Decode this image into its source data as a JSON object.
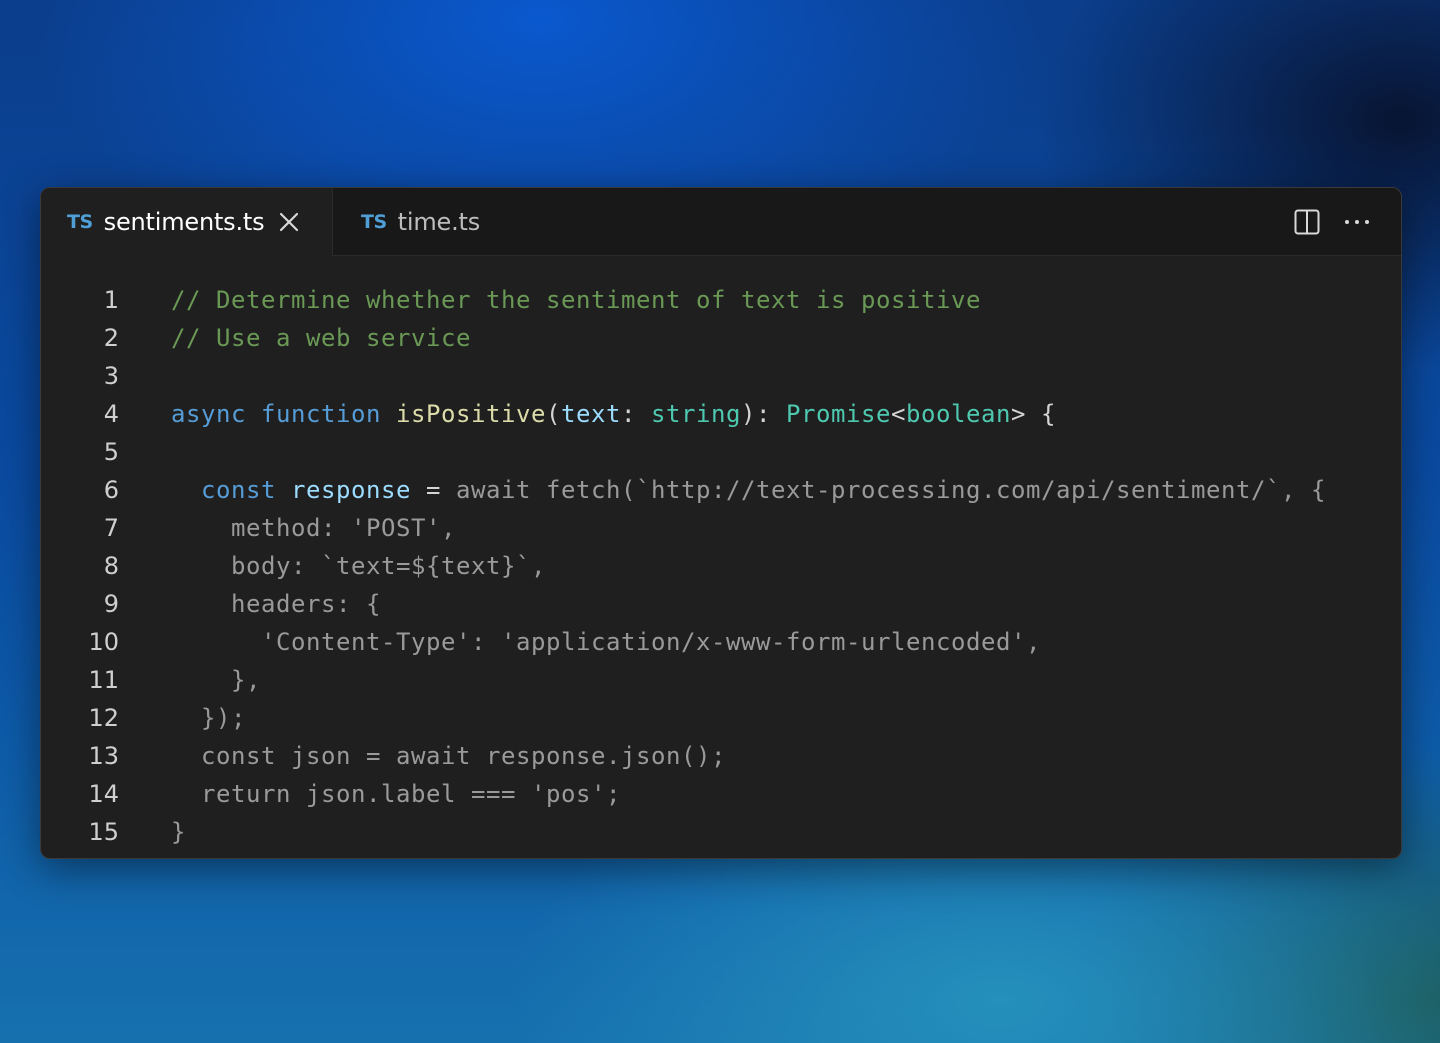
{
  "tabs": [
    {
      "icon": "TS",
      "label": "sentiments.ts",
      "active": true
    },
    {
      "icon": "TS",
      "label": "time.ts",
      "active": false
    }
  ],
  "actions": [
    "split-editor-icon",
    "more-actions-icon"
  ],
  "colors": {
    "comment": "#6a9955",
    "keyword": "#569cd6",
    "function": "#dcdcaa",
    "parameter": "#9cdcfe",
    "type": "#4ec9b0",
    "dimmed": "#9a9a9a",
    "editor_bg": "#1f1f1f"
  },
  "code": {
    "line_numbers": [
      "1",
      "2",
      "3",
      "4",
      "5",
      "6",
      "7",
      "8",
      "9",
      "10",
      "11",
      "12",
      "13",
      "14",
      "15"
    ],
    "l1": "// Determine whether the sentiment of text is positive",
    "l2": "// Use a web service",
    "l4": {
      "kw_async": "async",
      "kw_function": "function",
      "fn_name": "isPositive",
      "open": "(",
      "param": "text",
      "colon": ": ",
      "type_string": "string",
      "close": "): ",
      "type_promise": "Promise",
      "lt": "<",
      "type_boolean": "boolean",
      "gt": "> {"
    },
    "l6": {
      "indent": "  ",
      "kw_const": "const",
      "var": "response",
      "eq": " = ",
      "rest": "await fetch(`http://text-processing.com/api/sentiment/`, {"
    },
    "l7": "    method: 'POST',",
    "l8": "    body: `text=${text}`,",
    "l9": "    headers: {",
    "l10": "      'Content-Type': 'application/x-www-form-urlencoded',",
    "l11": "    },",
    "l12": "  });",
    "l13": "  const json = await response.json();",
    "l14": "  return json.label === 'pos';",
    "l15": "}"
  }
}
